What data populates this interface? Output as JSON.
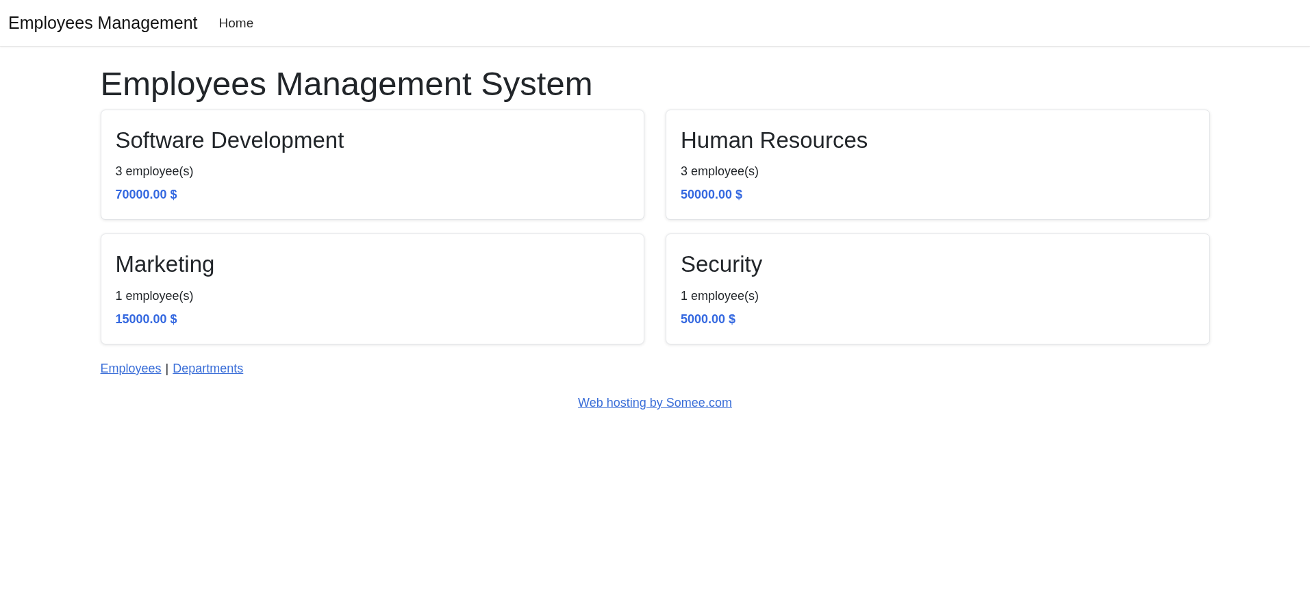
{
  "navbar": {
    "brand": "Employees Management",
    "links": [
      {
        "label": "Home"
      }
    ]
  },
  "page": {
    "title": "Employees Management System"
  },
  "departments": [
    {
      "name": "Software Development",
      "employee_count": "3 employee(s)",
      "salary": "70000.00 $"
    },
    {
      "name": "Human Resources",
      "employee_count": "3 employee(s)",
      "salary": "50000.00 $"
    },
    {
      "name": "Marketing",
      "employee_count": "1 employee(s)",
      "salary": "15000.00 $"
    },
    {
      "name": "Security",
      "employee_count": "1 employee(s)",
      "salary": "5000.00 $"
    }
  ],
  "footer_links": {
    "items": [
      "Employees",
      "Departments"
    ],
    "separator": "|"
  },
  "hosting_link": "Web hosting by Somee.com"
}
